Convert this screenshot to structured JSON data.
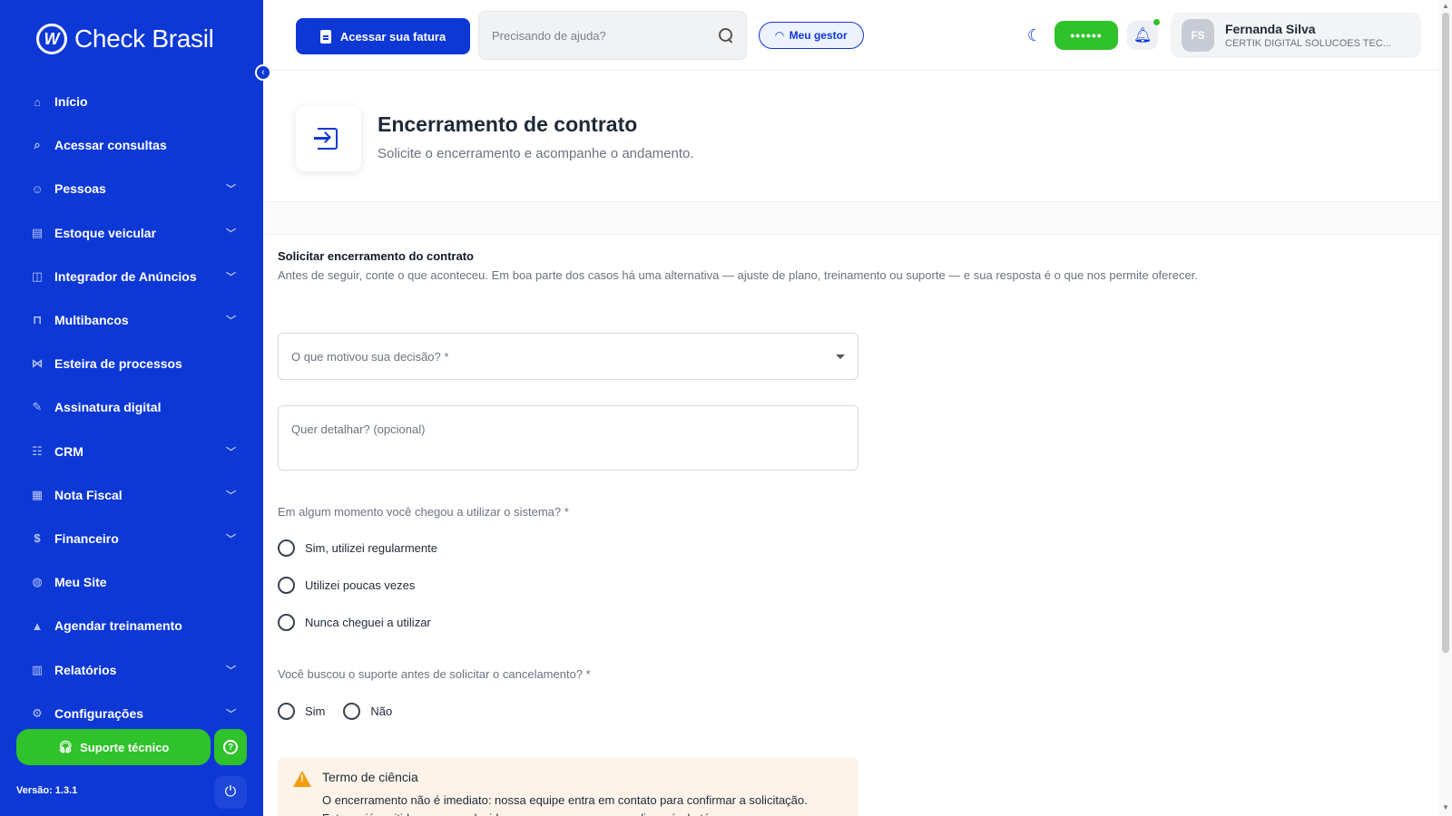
{
  "brand": {
    "name": "Check Brasil",
    "mark": "W"
  },
  "sidebar": {
    "items": [
      {
        "label": "Início",
        "icon": "home-icon",
        "glyph": "⌂",
        "expandable": false
      },
      {
        "label": "Acessar consultas",
        "icon": "search-icon",
        "glyph": "⌕",
        "expandable": false
      },
      {
        "label": "Pessoas",
        "icon": "people-icon",
        "glyph": "☺",
        "expandable": true
      },
      {
        "label": "Estoque veicular",
        "icon": "vehicle-icon",
        "glyph": "▤",
        "expandable": true
      },
      {
        "label": "Integrador de Anúncios",
        "icon": "ads-icon",
        "glyph": "◫",
        "expandable": true
      },
      {
        "label": "Multibancos",
        "icon": "bank-icon",
        "glyph": "⊓",
        "expandable": true
      },
      {
        "label": "Esteira de processos",
        "icon": "workflow-icon",
        "glyph": "⋈",
        "expandable": false
      },
      {
        "label": "Assinatura digital",
        "icon": "signature-icon",
        "glyph": "✎",
        "expandable": false
      },
      {
        "label": "CRM",
        "icon": "crm-icon",
        "glyph": "☷",
        "expandable": true
      },
      {
        "label": "Nota Fiscal",
        "icon": "invoice-icon",
        "glyph": "▦",
        "expandable": true
      },
      {
        "label": "Financeiro",
        "icon": "finance-icon",
        "glyph": "$",
        "expandable": true
      },
      {
        "label": "Meu Site",
        "icon": "globe-icon",
        "glyph": "◍",
        "expandable": false
      },
      {
        "label": "Agendar treinamento",
        "icon": "graduation-icon",
        "glyph": "▲",
        "expandable": false
      },
      {
        "label": "Relatórios",
        "icon": "chart-icon",
        "glyph": "▥",
        "expandable": true
      },
      {
        "label": "Configurações",
        "icon": "gear-icon",
        "glyph": "⚙",
        "expandable": true
      }
    ],
    "support_label": "Suporte técnico",
    "version": "Versão: 1.3.1"
  },
  "header": {
    "invoice_button": "Acessar sua fatura",
    "search_placeholder": "Precisando de ajuda?",
    "manager_button": "Meu gestor",
    "password_pill": "••••••",
    "user": {
      "initials": "FS",
      "name": "Fernanda Silva",
      "company": "CERTIK DIGITAL SOLUCOES TEC..."
    }
  },
  "page": {
    "title": "Encerramento de contrato",
    "subtitle": "Solicite o encerramento e acompanhe o andamento."
  },
  "form": {
    "section_title": "Solicitar encerramento do contrato",
    "section_desc": "Antes de seguir, conte o que aconteceu. Em boa parte dos casos há uma alternativa — ajuste de plano, treinamento ou suporte — e sua resposta é o que nos permite oferecer.",
    "reason_placeholder": "O que motivou sua decisão? *",
    "details_placeholder": "Quer detalhar? (opcional)",
    "usage_question": "Em algum momento você chegou a utilizar o sistema? *",
    "usage_options": [
      "Sim, utilizei regularmente",
      "Utilizei poucas vezes",
      "Nunca cheguei a utilizar"
    ],
    "support_question": "Você buscou o suporte antes de solicitar o cancelamento? *",
    "support_options": [
      "Sim",
      "Não"
    ],
    "notice_title": "Termo de ciência",
    "notice_text": "O encerramento não é imediato: nossa equipe entra em contato para confirmar a solicitação. Faturas já emitidas seguem devidas e o acesso permanece disponível até o"
  },
  "colors": {
    "primary": "#0d38d6",
    "success": "#2fc22a",
    "warning_bg": "#fdf3e9",
    "warning": "#f59e0b"
  }
}
